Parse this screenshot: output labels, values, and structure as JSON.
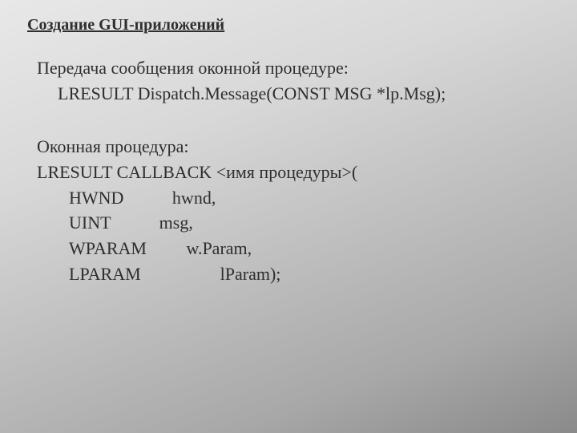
{
  "title": "Создание GUI-приложений",
  "section1": {
    "caption": "Передача сообщения оконной процедуре:",
    "code": "LRESULT Dispatch.Message(CONST MSG *lp.Msg);"
  },
  "section2": {
    "caption": "Оконная процедура:",
    "line_decl": "LRESULT CALLBACK <имя процедуры>(",
    "params": [
      "HWND           hwnd,",
      "UINT           msg,",
      "WPARAM         w.Param,",
      "LPARAM                  lParam);"
    ]
  }
}
